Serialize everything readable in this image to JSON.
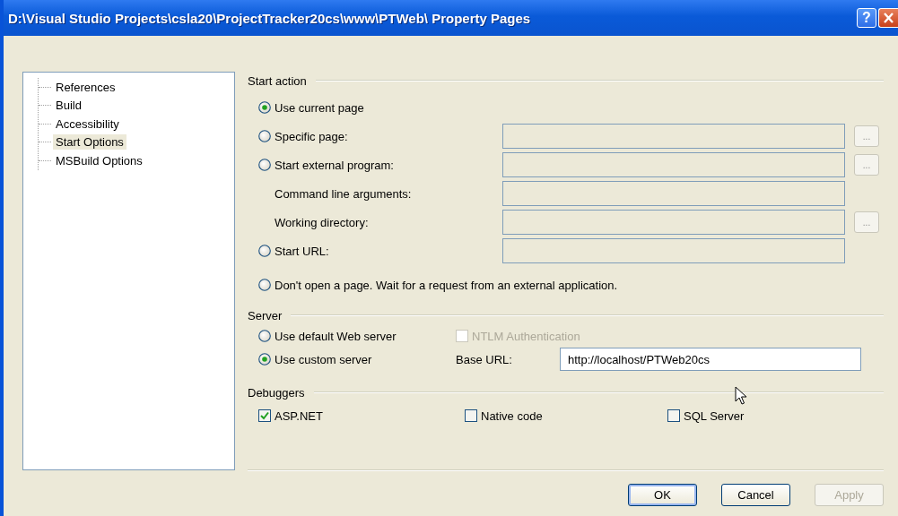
{
  "window": {
    "title": "D:\\Visual Studio Projects\\csla20\\ProjectTracker20cs\\www\\PTWeb\\ Property Pages",
    "help_button": "?"
  },
  "tree": {
    "items": [
      {
        "label": "References",
        "selected": false
      },
      {
        "label": "Build",
        "selected": false
      },
      {
        "label": "Accessibility",
        "selected": false
      },
      {
        "label": "Start Options",
        "selected": true
      },
      {
        "label": "MSBuild Options",
        "selected": false
      }
    ]
  },
  "start_action": {
    "heading": "Start action",
    "rows": [
      {
        "kind": "radio",
        "label": "Use current page",
        "selected": true
      },
      {
        "kind": "radio",
        "label": "Specific page:",
        "selected": false,
        "field": {
          "disabled": true
        },
        "browse_button": "..."
      },
      {
        "kind": "radio",
        "label": "Start external program:",
        "selected": false,
        "field": {
          "disabled": true
        },
        "browse_button": "..."
      },
      {
        "kind": "label",
        "label": "Command line arguments:",
        "field": {
          "disabled": true
        }
      },
      {
        "kind": "label",
        "label": "Working directory:",
        "field": {
          "disabled": true
        },
        "browse_button": "..."
      },
      {
        "kind": "radio",
        "label": "Start URL:",
        "selected": false,
        "field": {
          "disabled": true
        }
      },
      {
        "kind": "radio",
        "label": "Don't open a page. Wait for a request from an external application.",
        "selected": false
      }
    ]
  },
  "server": {
    "heading": "Server",
    "options": [
      {
        "label": "Use default Web server",
        "selected": false
      },
      {
        "label": "Use custom server",
        "selected": true
      }
    ],
    "ntlm": {
      "label": "NTLM Authentication",
      "checked": false,
      "disabled": true
    },
    "base_url": {
      "label": "Base URL:",
      "value": "http://localhost/PTWeb20cs"
    }
  },
  "debuggers": {
    "heading": "Debuggers",
    "items": [
      {
        "label": "ASP.NET",
        "checked": true
      },
      {
        "label": "Native code",
        "checked": false
      },
      {
        "label": "SQL Server",
        "checked": false
      }
    ]
  },
  "buttons": [
    {
      "label": "OK",
      "default": true,
      "disabled": false
    },
    {
      "label": "Cancel",
      "default": false,
      "disabled": false
    },
    {
      "label": "Apply",
      "default": false,
      "disabled": true
    }
  ]
}
